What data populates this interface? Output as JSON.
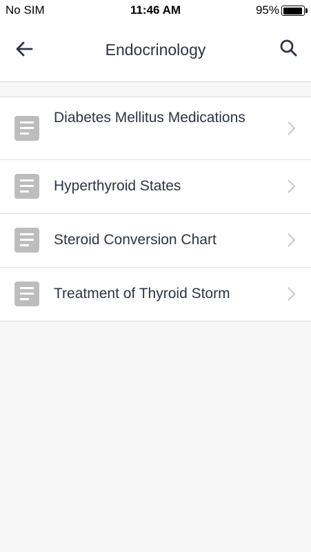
{
  "status_bar": {
    "carrier": "No SIM",
    "time": "11:46 AM",
    "battery_percent": "95%",
    "battery_level": 0.95
  },
  "nav": {
    "title": "Endocrinology",
    "back_icon": "arrow-left-icon",
    "search_icon": "search-icon"
  },
  "items": [
    {
      "label": "Diabetes Mellitus Medications",
      "icon": "document-icon"
    },
    {
      "label": "Hyperthyroid States",
      "icon": "document-icon"
    },
    {
      "label": "Steroid Conversion Chart",
      "icon": "document-icon"
    },
    {
      "label": "Treatment of Thyroid Storm",
      "icon": "document-icon"
    }
  ],
  "colors": {
    "text": "#2b3445",
    "icon_gray": "#bdbdbd",
    "chevron": "#c7c7cc",
    "background": "#f7f7f7"
  }
}
